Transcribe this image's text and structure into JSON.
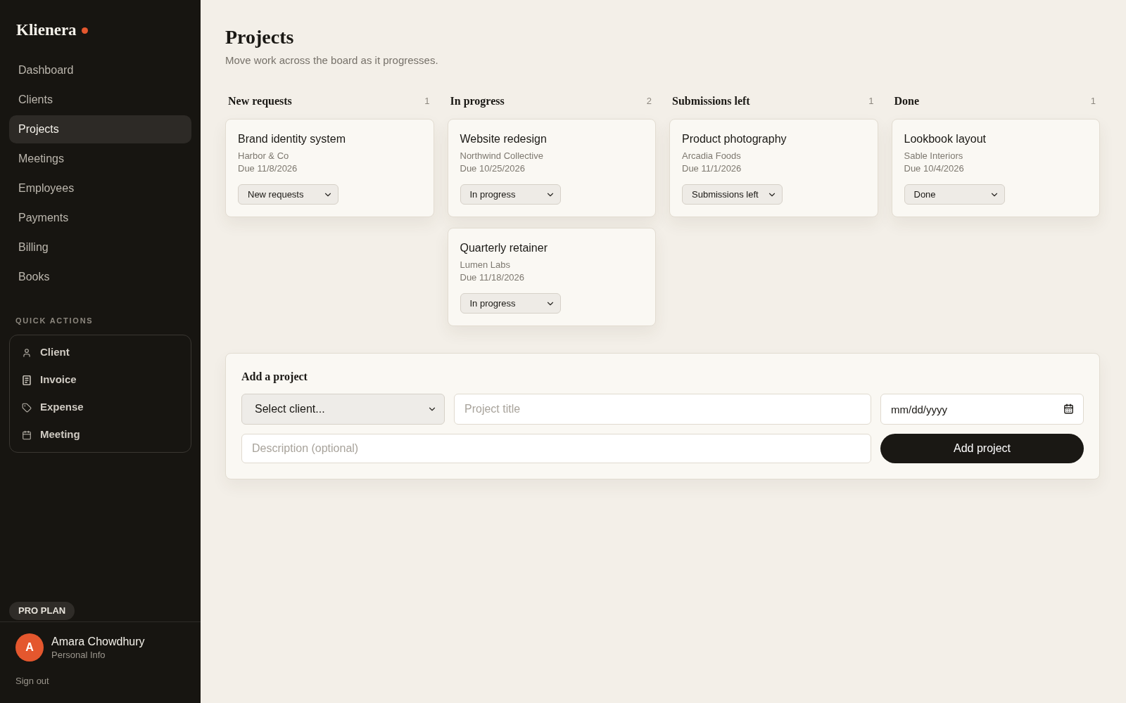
{
  "sidebar": {
    "logo": "Klienera",
    "nav": [
      {
        "label": "Dashboard",
        "selected": false
      },
      {
        "label": "Clients",
        "selected": false
      },
      {
        "label": "Projects",
        "selected": true
      },
      {
        "label": "Meetings",
        "selected": false
      },
      {
        "label": "Employees",
        "selected": false
      },
      {
        "label": "Payments",
        "selected": false
      },
      {
        "label": "Billing",
        "selected": false
      },
      {
        "label": "Books",
        "selected": false
      }
    ],
    "quick_actions": {
      "title": "QUICK ACTIONS",
      "items": [
        "Client",
        "Invoice",
        "Expense",
        "Meeting"
      ]
    },
    "plan_badge": "PRO PLAN",
    "user": {
      "initial": "A",
      "name": "Amara Chowdhury",
      "subtitle": "Personal Info"
    },
    "sign_out": "Sign out"
  },
  "page": {
    "title": "Projects",
    "subtitle": "Move work across the board as it progresses."
  },
  "board": {
    "columns": [
      {
        "title": "New requests",
        "count": "1",
        "cards": [
          {
            "title": "Brand identity system",
            "client": "Harbor & Co",
            "due": "Due 11/8/2026",
            "status": "New requests"
          }
        ]
      },
      {
        "title": "In progress",
        "count": "2",
        "cards": [
          {
            "title": "Website redesign",
            "client": "Northwind Collective",
            "due": "Due 10/25/2026",
            "status": "In progress"
          },
          {
            "title": "Quarterly retainer",
            "client": "Lumen Labs",
            "due": "Due 11/18/2026",
            "status": "In progress"
          }
        ]
      },
      {
        "title": "Submissions left",
        "count": "1",
        "cards": [
          {
            "title": "Product photography",
            "client": "Arcadia Foods",
            "due": "Due 11/1/2026",
            "status": "Submissions left"
          }
        ]
      },
      {
        "title": "Done",
        "count": "1",
        "cards": [
          {
            "title": "Lookbook layout",
            "client": "Sable Interiors",
            "due": "Due 10/4/2026",
            "status": "Done"
          }
        ]
      }
    ]
  },
  "add_project": {
    "title": "Add a project",
    "client_select": {
      "value": "Select client..."
    },
    "project_title": {
      "placeholder": "Project title"
    },
    "due_date": {
      "placeholder": "mm/dd/yyyy"
    },
    "description": {
      "placeholder": "Description (optional)"
    },
    "submit": "Add project"
  }
}
